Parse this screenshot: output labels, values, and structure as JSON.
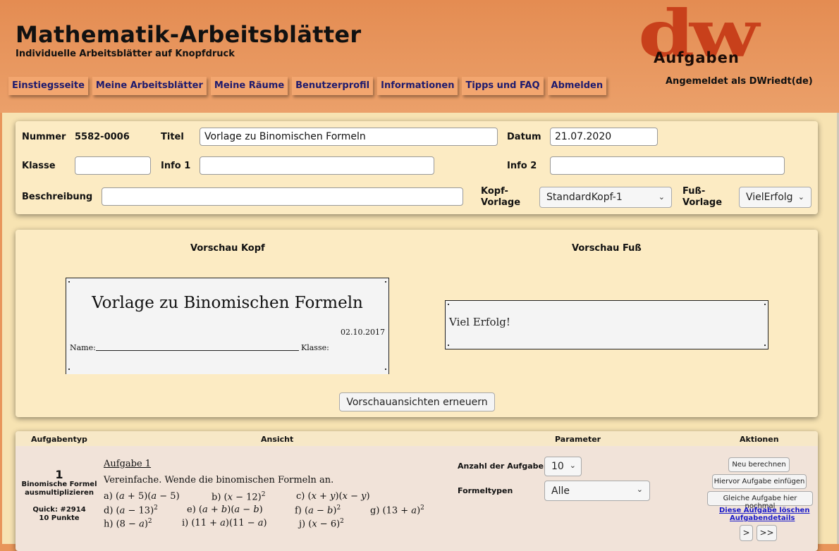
{
  "header": {
    "title": "Mathematik-Arbeitsblätter",
    "subtitle": "Individuelle Arbeitsblätter auf Knopfdruck",
    "logo": {
      "main": "dw",
      "sub": "Aufgaben"
    },
    "login_status": "Angemeldet als DWriedt(de)"
  },
  "nav": [
    "Einstiegsseite",
    "Meine Arbeitsblätter",
    "Meine Räume",
    "Benutzerprofil",
    "Informationen",
    "Tipps und FAQ",
    "Abmelden"
  ],
  "meta": {
    "nummer_label": "Nummer",
    "nummer_value": "5582-0006",
    "titel_label": "Titel",
    "titel_value": "Vorlage zu Binomischen Formeln",
    "datum_label": "Datum",
    "datum_value": "21.07.2020",
    "klasse_label": "Klasse",
    "klasse_value": "",
    "info1_label": "Info 1",
    "info1_value": "",
    "info2_label": "Info 2",
    "info2_value": "",
    "beschreibung_label": "Beschreibung",
    "beschreibung_value": "",
    "kopf_label_1": "Kopf-",
    "kopf_label_2": "Vorlage",
    "kopf_value": "StandardKopf-1",
    "fuss_label_1": "Fuß-",
    "fuss_label_2": "Vorlage",
    "fuss_value": "VielErfolg"
  },
  "preview": {
    "kopf_title": "Vorschau Kopf",
    "fuss_title": "Vorschau Fuß",
    "head_heading": "Vorlage zu Binomischen Formeln",
    "head_date": "02.10.2017",
    "head_name": "Name:",
    "head_klasse": "Klasse:",
    "foot_text": "Viel Erfolg!",
    "refresh_button": "Vorschauansichten erneuern"
  },
  "tasks": {
    "headers": [
      "Aufgabentyp",
      "Ansicht",
      "Parameter",
      "Aktionen"
    ],
    "item": {
      "number": "1",
      "type_line1": "Binomische Formel",
      "type_line2": "ausmultiplizieren",
      "quick": "Quick: #2914",
      "points": "10 Punkte",
      "aufgabe_title": "Aufgabe 1",
      "instruction": "Vereinfache. Wende die binomischen Formeln an.",
      "param_count_label": "Anzahl der Aufgaben",
      "param_count_value": "10",
      "param_types_label": "Formeltypen",
      "param_types_value": "Alle",
      "btn_recalc": "Neu berechnen",
      "btn_insert": "Hiervor Aufgabe einfügen",
      "btn_same": "Gleiche Aufgabe hier nochmal",
      "link_delete": "Diese Aufgabe löschen",
      "link_details": "Aufgabendetails",
      "btn_next": ">",
      "btn_last": ">>"
    }
  }
}
